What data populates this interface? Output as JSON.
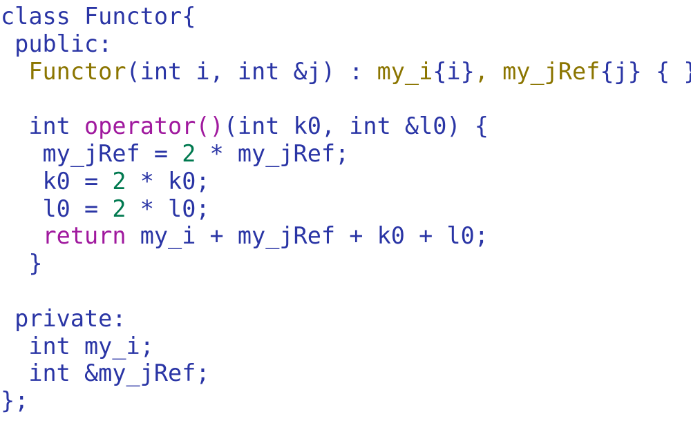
{
  "document": {
    "kind": "code-listing",
    "language": "C++",
    "background_color": "#ffffff",
    "palette": {
      "plain": "#2a35a5",
      "member": "#8b7500",
      "operator": "#a0199e",
      "number": "#00794f"
    }
  },
  "code": {
    "lines": [
      {
        "index": 0,
        "text": "class Functor{",
        "tokens": [
          {
            "text": "class Functor{",
            "kind": "plain"
          }
        ]
      },
      {
        "index": 1,
        "text": " public:",
        "tokens": [
          {
            "text": " public:",
            "kind": "plain"
          }
        ]
      },
      {
        "index": 2,
        "text": "  Functor(int i, int &j) : my_i{i}, my_jRef{j} { }",
        "tokens": [
          {
            "text": "  ",
            "kind": "plain"
          },
          {
            "text": "Functor",
            "kind": "ctor"
          },
          {
            "text": "(int i, int &j) : ",
            "kind": "plain"
          },
          {
            "text": "my_i",
            "kind": "member"
          },
          {
            "text": "{i}",
            "kind": "punct"
          },
          {
            "text": ", ",
            "kind": "member"
          },
          {
            "text": "my_jRef",
            "kind": "member"
          },
          {
            "text": "{j}",
            "kind": "punct"
          },
          {
            "text": " { }",
            "kind": "plain"
          }
        ]
      },
      {
        "index": 3,
        "text": "",
        "tokens": []
      },
      {
        "index": 4,
        "text": "  int operator()(int k0, int &l0) {",
        "tokens": [
          {
            "text": "  int ",
            "kind": "plain"
          },
          {
            "text": "operator",
            "kind": "operator"
          },
          {
            "text": "()",
            "kind": "operator"
          },
          {
            "text": "(int k0, int &l0) {",
            "kind": "plain"
          }
        ]
      },
      {
        "index": 5,
        "text": "   my_jRef = 2 * my_jRef;",
        "tokens": [
          {
            "text": "   my_jRef = ",
            "kind": "plain"
          },
          {
            "text": "2",
            "kind": "number"
          },
          {
            "text": " * my_jRef;",
            "kind": "plain"
          }
        ]
      },
      {
        "index": 6,
        "text": "   k0 = 2 * k0;",
        "tokens": [
          {
            "text": "   k0 = ",
            "kind": "plain"
          },
          {
            "text": "2",
            "kind": "number"
          },
          {
            "text": " * k0;",
            "kind": "plain"
          }
        ]
      },
      {
        "index": 7,
        "text": "   l0 = 2 * l0;",
        "tokens": [
          {
            "text": "   l0 = ",
            "kind": "plain"
          },
          {
            "text": "2",
            "kind": "number"
          },
          {
            "text": " * l0;",
            "kind": "plain"
          }
        ]
      },
      {
        "index": 8,
        "text": "   return my_i + my_jRef + k0 + l0;",
        "tokens": [
          {
            "text": "   ",
            "kind": "plain"
          },
          {
            "text": "return",
            "kind": "return"
          },
          {
            "text": " my_i + my_jRef + k0 + l0;",
            "kind": "plain"
          }
        ]
      },
      {
        "index": 9,
        "text": "  }",
        "tokens": [
          {
            "text": "  }",
            "kind": "plain"
          }
        ]
      },
      {
        "index": 10,
        "text": "",
        "tokens": []
      },
      {
        "index": 11,
        "text": " private:",
        "tokens": [
          {
            "text": " private:",
            "kind": "plain"
          }
        ]
      },
      {
        "index": 12,
        "text": "  int my_i;",
        "tokens": [
          {
            "text": "  int my_i;",
            "kind": "plain"
          }
        ]
      },
      {
        "index": 13,
        "text": "  int &my_jRef;",
        "tokens": [
          {
            "text": "  int &my_jRef;",
            "kind": "plain"
          }
        ]
      },
      {
        "index": 14,
        "text": "};",
        "tokens": [
          {
            "text": "};",
            "kind": "plain"
          }
        ]
      }
    ]
  }
}
